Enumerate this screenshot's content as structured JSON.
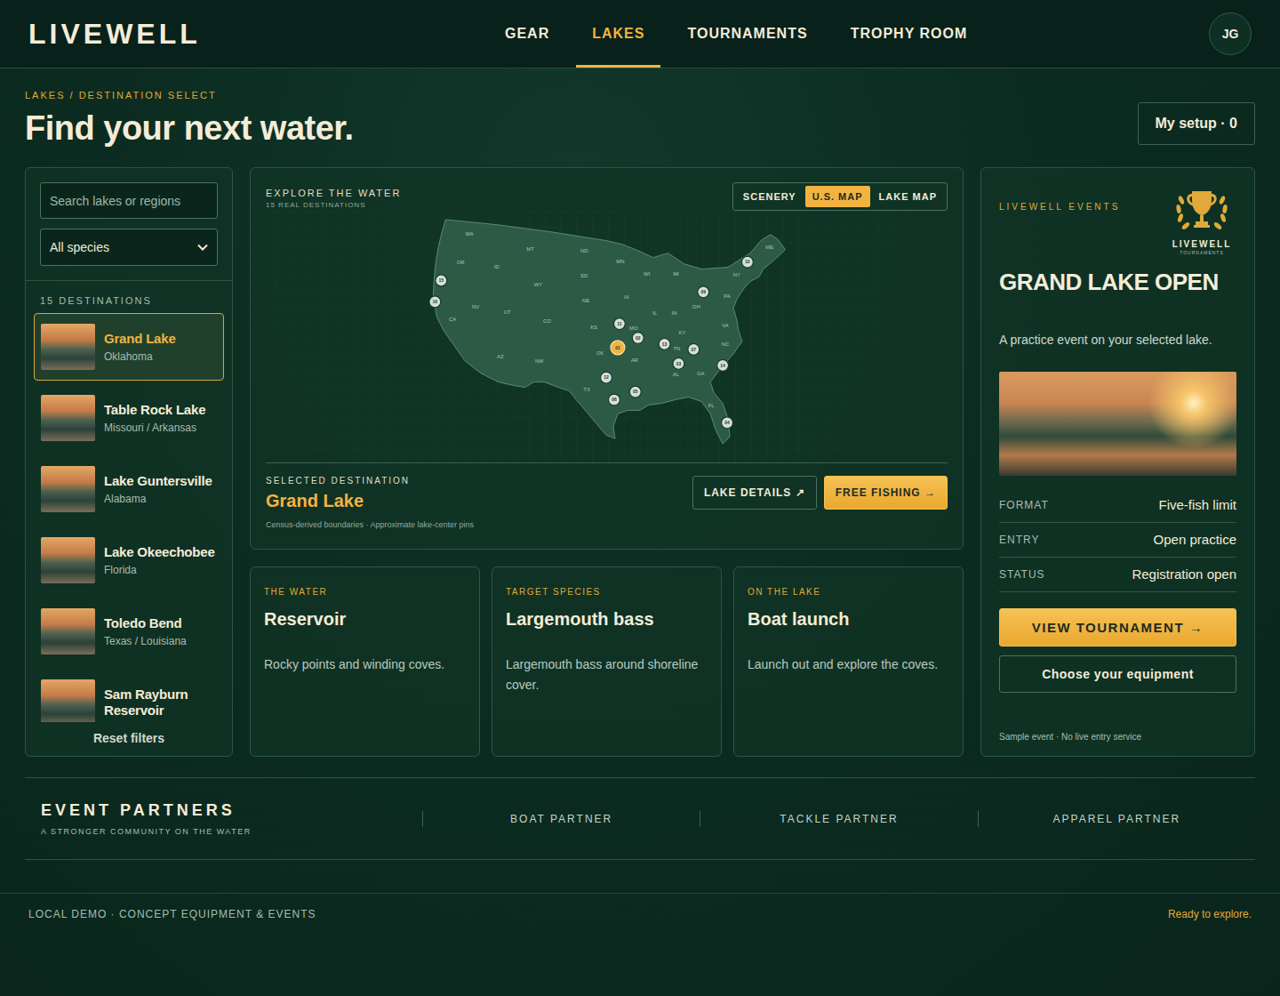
{
  "header": {
    "logo": "LIVEWELL",
    "nav": [
      {
        "label": "GEAR",
        "selected": false
      },
      {
        "label": "LAKES",
        "selected": true
      },
      {
        "label": "TOURNAMENTS",
        "selected": false
      },
      {
        "label": "TROPHY ROOM",
        "selected": false
      }
    ],
    "avatar": "JG"
  },
  "page": {
    "breadcrumb": "LAKES / DESTINATION SELECT",
    "title": "Find your next water.",
    "setup_button": "My setup · 0"
  },
  "filters": {
    "search_placeholder": "Search lakes or regions",
    "species": "All species"
  },
  "destinations": {
    "count_label": "15 DESTINATIONS",
    "items": [
      {
        "name": "Grand Lake",
        "region": "Oklahoma",
        "selected": true
      },
      {
        "name": "Table Rock Lake",
        "region": "Missouri / Arkansas",
        "selected": false
      },
      {
        "name": "Lake Guntersville",
        "region": "Alabama",
        "selected": false
      },
      {
        "name": "Lake Okeechobee",
        "region": "Florida",
        "selected": false
      },
      {
        "name": "Toledo Bend",
        "region": "Texas / Louisiana",
        "selected": false
      },
      {
        "name": "Sam Rayburn Reservoir",
        "region": "",
        "selected": false
      }
    ],
    "reset": "Reset filters"
  },
  "map_panel": {
    "eyebrow": "EXPLORE THE WATER",
    "subtitle": "15 REAL DESTINATIONS",
    "views": [
      {
        "label": "SCENERY",
        "selected": false
      },
      {
        "label": "U.S. MAP",
        "selected": true
      },
      {
        "label": "LAKE MAP",
        "selected": false
      }
    ],
    "state_labels": [
      "WA",
      "OR",
      "CA",
      "NV",
      "ID",
      "MT",
      "WY",
      "UT",
      "AZ",
      "CO",
      "NM",
      "ND",
      "SD",
      "NE",
      "KS",
      "OK",
      "TX",
      "MN",
      "IA",
      "MO",
      "AR",
      "WI",
      "IL",
      "MI",
      "IN",
      "OH",
      "KY",
      "TN",
      "AL",
      "GA",
      "FL",
      "NC",
      "VA",
      "PA",
      "NY",
      "ME"
    ],
    "pins": [
      {
        "label": "01",
        "selected": true
      },
      {
        "label": "02",
        "selected": false
      },
      {
        "label": "03",
        "selected": false
      },
      {
        "label": "04",
        "selected": false
      },
      {
        "label": "05",
        "selected": false
      },
      {
        "label": "06",
        "selected": false
      },
      {
        "label": "07",
        "selected": false
      },
      {
        "label": "09",
        "selected": false
      },
      {
        "label": "10",
        "selected": false
      },
      {
        "label": "11",
        "selected": false
      },
      {
        "label": "12",
        "selected": false
      },
      {
        "label": "13",
        "selected": false
      },
      {
        "label": "14",
        "selected": false
      },
      {
        "label": "15",
        "selected": false
      },
      {
        "label": "16",
        "selected": false
      }
    ],
    "selected_label": "SELECTED DESTINATION",
    "selected_name": "Grand Lake",
    "footnote": "Census-derived boundaries · Approximate lake-center pins",
    "details_button": "LAKE DETAILS ↗",
    "primary_button": "FREE FISHING →"
  },
  "info_cards": [
    {
      "eyebrow": "THE WATER",
      "title": "Reservoir",
      "text": "Rocky points and winding coves."
    },
    {
      "eyebrow": "TARGET SPECIES",
      "title": "Largemouth bass",
      "text": "Largemouth bass around shoreline cover."
    },
    {
      "eyebrow": "ON THE LAKE",
      "title": "Boat launch",
      "text": "Launch out and explore the coves."
    }
  ],
  "event": {
    "eyebrow": "LIVEWELL EVENTS",
    "logo_title": "LIVEWELL",
    "logo_subtitle": "TOURNAMENTS",
    "title": "GRAND LAKE OPEN",
    "description": "A practice event on your selected lake.",
    "rows": [
      {
        "label": "FORMAT",
        "value": "Five-fish limit"
      },
      {
        "label": "ENTRY",
        "value": "Open practice"
      },
      {
        "label": "STATUS",
        "value": "Registration open"
      }
    ],
    "primary_button": "VIEW TOURNAMENT →",
    "secondary_button": "Choose your equipment",
    "note": "Sample event · No live entry service"
  },
  "partners": {
    "title": "EVENT PARTNERS",
    "subtitle": "A STRONGER COMMUNITY ON THE WATER",
    "items": [
      "BOAT PARTNER",
      "TACKLE PARTNER",
      "APPAREL PARTNER"
    ]
  },
  "footer": {
    "left": "LOCAL DEMO · CONCEPT EQUIPMENT & EVENTS",
    "right": "Ready to explore."
  }
}
